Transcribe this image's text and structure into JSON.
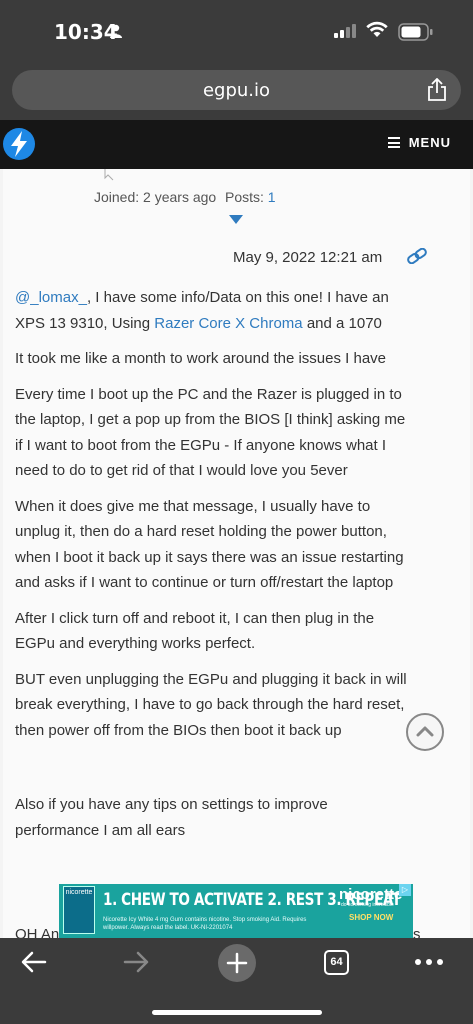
{
  "status_bar": {
    "time": "10:34"
  },
  "browser": {
    "url": "egpu.io"
  },
  "site_nav": {
    "menu_label": "MENU"
  },
  "author": {
    "joined": "Joined: 2 years ago",
    "posts_label": "Posts:",
    "posts_count": "1"
  },
  "post": {
    "date": "May 9, 2022 12:21 am",
    "mention": "@_lomax_",
    "p1_after_mention": ", I have some info/Data on this one! I have an",
    "p1_line2_before": "XPS 13 9310, Using ",
    "p1_link": "Razer Core X Chroma",
    "p1_line2_after": " and a 1070",
    "lines": [
      "It took me like a month to work around the issues I have",
      "Every time I boot up the PC and the Razer is plugged in to",
      "the laptop, I get a pop up from the BIOS [I think] asking me",
      "if I want to boot from the EGPu - If anyone knows what I",
      "need to do to get rid of that I would love you 5ever",
      "When it does give me that message, I usually have to",
      "unplug it, then do a hard reset holding the power button,",
      "when I boot it back up it says there was an issue restarting",
      "and asks if I want to continue or turn off/restart the laptop",
      "After I click turn off and reboot it, I can then plug in the",
      "EGPu and everything works perfect.",
      "BUT even unplugging the EGPu and plugging it back in will",
      "break everything, I have to go back through the hard reset,",
      "then power off from the BIOs then boot it back up",
      "Also if you have any tips on settings to improve",
      "performance I am all ears"
    ],
    "cut_left": "OH An",
    "cut_right": "s"
  },
  "ad": {
    "logo_text": "nicorette",
    "headline": "1. CHEW TO ACTIVATE 2. REST 3. REPEAT",
    "fine_print": "Nicorette Icy White 4 mg Gum contains nicotine. Stop smoking Aid. Requires willpower. Always read the label. UK-NI-2201074",
    "brand": "nicorette",
    "tagline": "do something incredible",
    "cta": "SHOP NOW",
    "choice": "▷"
  },
  "toolbar": {
    "tab_count": "64"
  },
  "colors": {
    "link": "#2f7bbf",
    "chrome": "#3b3b3b",
    "nav": "#161616",
    "ad": "#1aa39e"
  }
}
